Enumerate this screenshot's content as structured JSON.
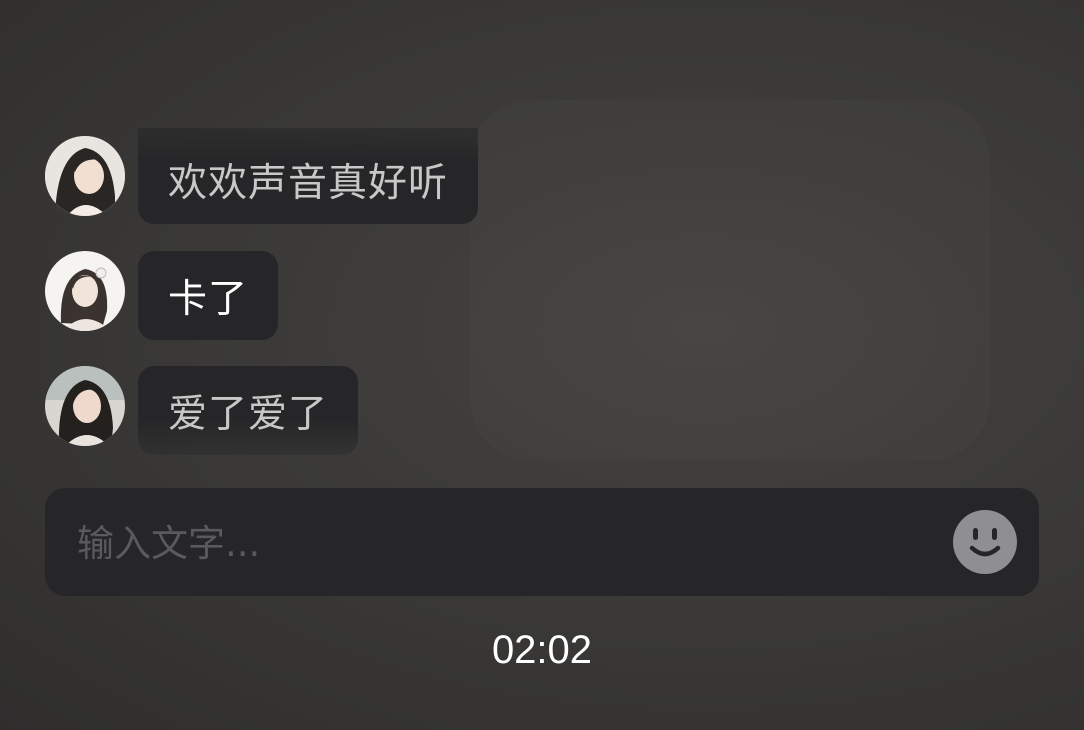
{
  "messages": [
    {
      "text": "欢欢声音真好听",
      "avatar_icon": "portrait-avatar-icon"
    },
    {
      "text": "卡了",
      "avatar_icon": "portrait-avatar-icon"
    },
    {
      "text": "爱了爱了",
      "avatar_icon": "portrait-avatar-icon"
    }
  ],
  "input": {
    "placeholder": "输入文字...",
    "emoji_icon": "smiley-face-icon"
  },
  "timer": "02:02",
  "colors": {
    "bubble_bg": "#262628",
    "input_bg": "#262628",
    "text_muted": "#c8c8c8",
    "text_bright": "#ffffff",
    "emoji_icon": "#8e8e93"
  }
}
